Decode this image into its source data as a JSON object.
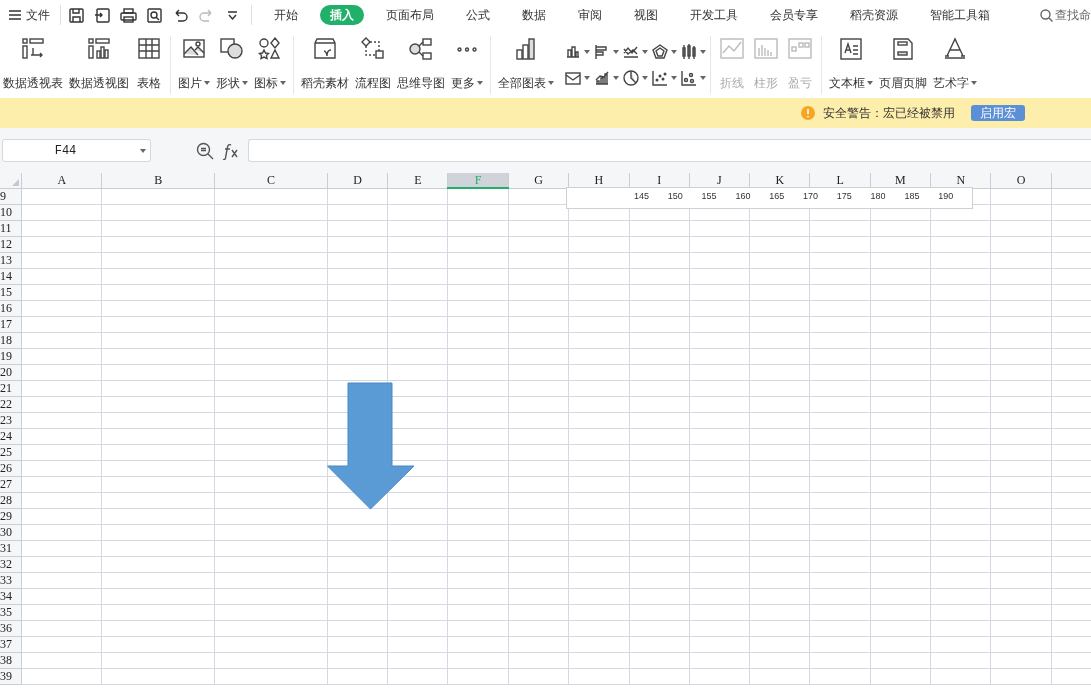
{
  "menu": {
    "label": "文件"
  },
  "tabs": [
    {
      "label": "开始",
      "selected": false
    },
    {
      "label": "插入",
      "selected": true
    },
    {
      "label": "页面布局",
      "selected": false
    },
    {
      "label": "公式",
      "selected": false
    },
    {
      "label": "数据",
      "selected": false
    },
    {
      "label": "审阅",
      "selected": false
    },
    {
      "label": "视图",
      "selected": false
    },
    {
      "label": "开发工具",
      "selected": false
    },
    {
      "label": "会员专享",
      "selected": false
    },
    {
      "label": "稻壳资源",
      "selected": false
    },
    {
      "label": "智能工具箱",
      "selected": false
    }
  ],
  "search": {
    "label": "查找命"
  },
  "ribbon": {
    "groups": [
      {
        "kind": "buttons",
        "items": [
          {
            "label": "数据透视表",
            "dropdown": false,
            "disabled": false
          },
          {
            "label": "数据透视图",
            "dropdown": false,
            "disabled": false
          },
          {
            "label": "表格",
            "dropdown": false,
            "disabled": false
          }
        ]
      },
      {
        "kind": "buttons",
        "items": [
          {
            "label": "图片",
            "dropdown": true,
            "disabled": false
          },
          {
            "label": "形状",
            "dropdown": true,
            "disabled": false
          },
          {
            "label": "图标",
            "dropdown": true,
            "disabled": false
          }
        ]
      },
      {
        "kind": "buttons",
        "items": [
          {
            "label": "稻壳素材",
            "dropdown": false,
            "disabled": false
          },
          {
            "label": "流程图",
            "dropdown": false,
            "disabled": false
          },
          {
            "label": "思维导图",
            "dropdown": false,
            "disabled": false
          },
          {
            "label": "更多",
            "dropdown": true,
            "disabled": false
          }
        ]
      },
      {
        "kind": "charts",
        "items": [
          {
            "label": "全部图表",
            "dropdown": true,
            "disabled": false
          }
        ]
      },
      {
        "kind": "buttons",
        "items": [
          {
            "label": "折线",
            "dropdown": false,
            "disabled": true
          },
          {
            "label": "柱形",
            "dropdown": false,
            "disabled": true
          },
          {
            "label": "盈亏",
            "dropdown": false,
            "disabled": true
          }
        ]
      },
      {
        "kind": "buttons",
        "items": [
          {
            "label": "文本框",
            "dropdown": true,
            "disabled": false
          },
          {
            "label": "页眉页脚",
            "dropdown": false,
            "disabled": false
          },
          {
            "label": "艺术字",
            "dropdown": true,
            "disabled": false
          }
        ]
      }
    ]
  },
  "security_bar": {
    "message": "安全警告：宏已经被禁用",
    "button": "启用宏"
  },
  "name_box": {
    "value": "F44"
  },
  "sheet": {
    "columns": [
      {
        "label": "A",
        "selected": false
      },
      {
        "label": "B",
        "selected": false
      },
      {
        "label": "C",
        "selected": false
      },
      {
        "label": "D",
        "selected": false
      },
      {
        "label": "E",
        "selected": false
      },
      {
        "label": "F",
        "selected": true
      },
      {
        "label": "G",
        "selected": false
      },
      {
        "label": "H",
        "selected": false
      },
      {
        "label": "I",
        "selected": false
      },
      {
        "label": "J",
        "selected": false
      },
      {
        "label": "K",
        "selected": false
      },
      {
        "label": "L",
        "selected": false
      },
      {
        "label": "M",
        "selected": false
      },
      {
        "label": "N",
        "selected": false
      },
      {
        "label": "O",
        "selected": false
      }
    ],
    "rows": [
      "9",
      "10",
      "11",
      "12",
      "13",
      "14",
      "15",
      "16",
      "17",
      "18",
      "19",
      "20",
      "21",
      "22",
      "23",
      "24",
      "25",
      "26",
      "27",
      "28",
      "29",
      "30",
      "31",
      "32",
      "33",
      "34",
      "35",
      "36",
      "37",
      "38",
      "39"
    ],
    "chart_axis_labels": [
      "145",
      "150",
      "155",
      "160",
      "165",
      "170",
      "175",
      "180",
      "185",
      "190"
    ]
  }
}
